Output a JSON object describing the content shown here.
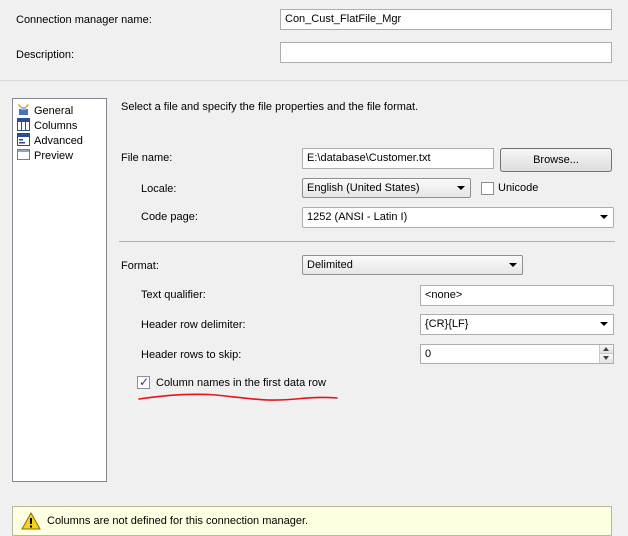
{
  "connection": {
    "name_label": "Connection manager name:",
    "name_value": "Con_Cust_FlatFile_Mgr",
    "description_label": "Description:",
    "description_value": ""
  },
  "sidebar": {
    "items": [
      {
        "label": "General",
        "icon": "general-icon"
      },
      {
        "label": "Columns",
        "icon": "columns-icon"
      },
      {
        "label": "Advanced",
        "icon": "advanced-icon"
      },
      {
        "label": "Preview",
        "icon": "preview-icon"
      }
    ]
  },
  "general": {
    "instruction": "Select a file and specify the file properties and the file format.",
    "file_name_label": "File name:",
    "file_name_value": "E:\\database\\Customer.txt",
    "browse_label": "Browse...",
    "locale_label": "Locale:",
    "locale_value": "English (United States)",
    "unicode_label": "Unicode",
    "unicode_checked": false,
    "code_page_label": "Code page:",
    "code_page_value": "1252  (ANSI - Latin I)",
    "format_label": "Format:",
    "format_value": "Delimited",
    "text_qualifier_label": "Text qualifier:",
    "text_qualifier_value": "<none>",
    "header_row_delimiter_label": "Header row delimiter:",
    "header_row_delimiter_value": "{CR}{LF}",
    "header_rows_skip_label": "Header rows to skip:",
    "header_rows_skip_value": "0",
    "column_names_label": "Column names in the first data row",
    "column_names_checked": true
  },
  "warning": {
    "icon": "warning-icon",
    "text": "Columns are not defined for this connection manager."
  },
  "colors": {
    "background": "#f0f0f0",
    "annotation_underline": "#e8141c",
    "warning_background": "#ffffe1"
  }
}
